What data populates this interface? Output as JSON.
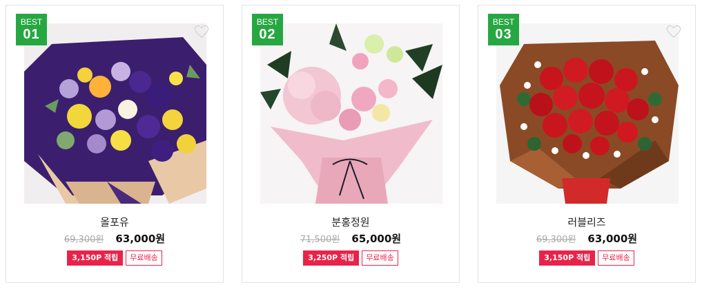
{
  "products": [
    {
      "badge_label": "BEST",
      "badge_rank": "01",
      "name": "올포유",
      "original_price": "69,300원",
      "sale_price": "63,000원",
      "points": "3,150P 적립",
      "shipping": "무료배송",
      "image_icon": "purple-yellow-bouquet-photo"
    },
    {
      "badge_label": "BEST",
      "badge_rank": "02",
      "name": "분홍정원",
      "original_price": "71,500원",
      "sale_price": "65,000원",
      "points": "3,250P 적립",
      "shipping": "무료배송",
      "image_icon": "pink-hydrangea-bouquet-photo"
    },
    {
      "badge_label": "BEST",
      "badge_rank": "03",
      "name": "러블리즈",
      "original_price": "69,300원",
      "sale_price": "63,000원",
      "points": "3,150P 적립",
      "shipping": "무료배송",
      "image_icon": "red-rose-bouquet-photo"
    }
  ],
  "colors": {
    "badge_bg": "#27a742",
    "point_tag_bg": "#e8234a",
    "shipping_tag_border": "#e8234a"
  }
}
